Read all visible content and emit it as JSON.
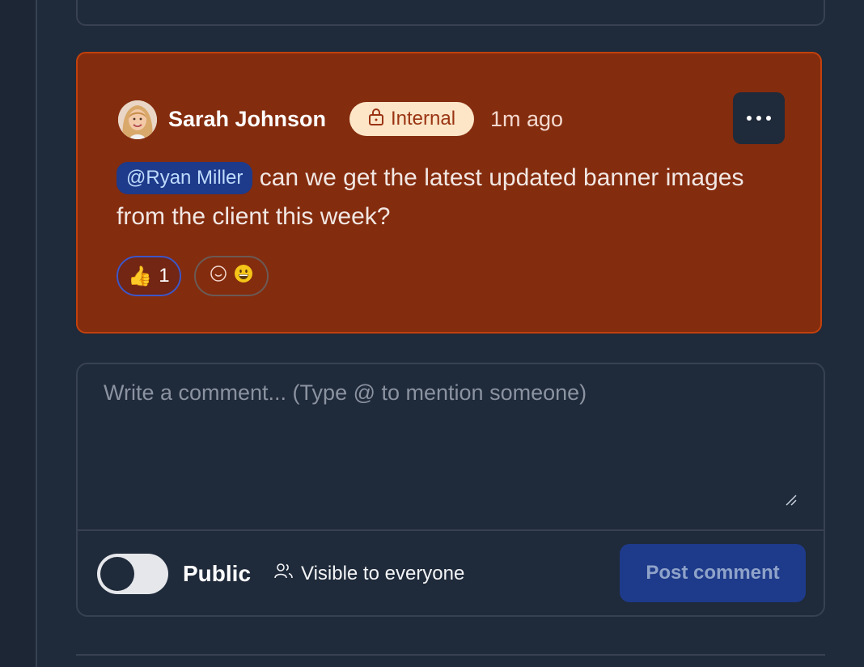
{
  "comment": {
    "author": "Sarah Johnson",
    "badge_label": "Internal",
    "time": "1m ago",
    "mention": "@Ryan Miller",
    "text": " can we get the latest updated banner images from the client this week?",
    "reactions": [
      {
        "emoji": "👍",
        "count": "1"
      }
    ]
  },
  "composer": {
    "placeholder": "Write a comment... (Type @ to mention someone)",
    "value": "",
    "toggle_label": "Public",
    "visibility_text": "Visible to everyone",
    "post_label": "Post comment"
  },
  "colors": {
    "card_bg": "#842c0e",
    "card_border": "#c2410c",
    "badge_bg": "#fde6c8",
    "mention_bg": "#1e3a8a",
    "post_btn_bg": "#1e3a8a"
  }
}
